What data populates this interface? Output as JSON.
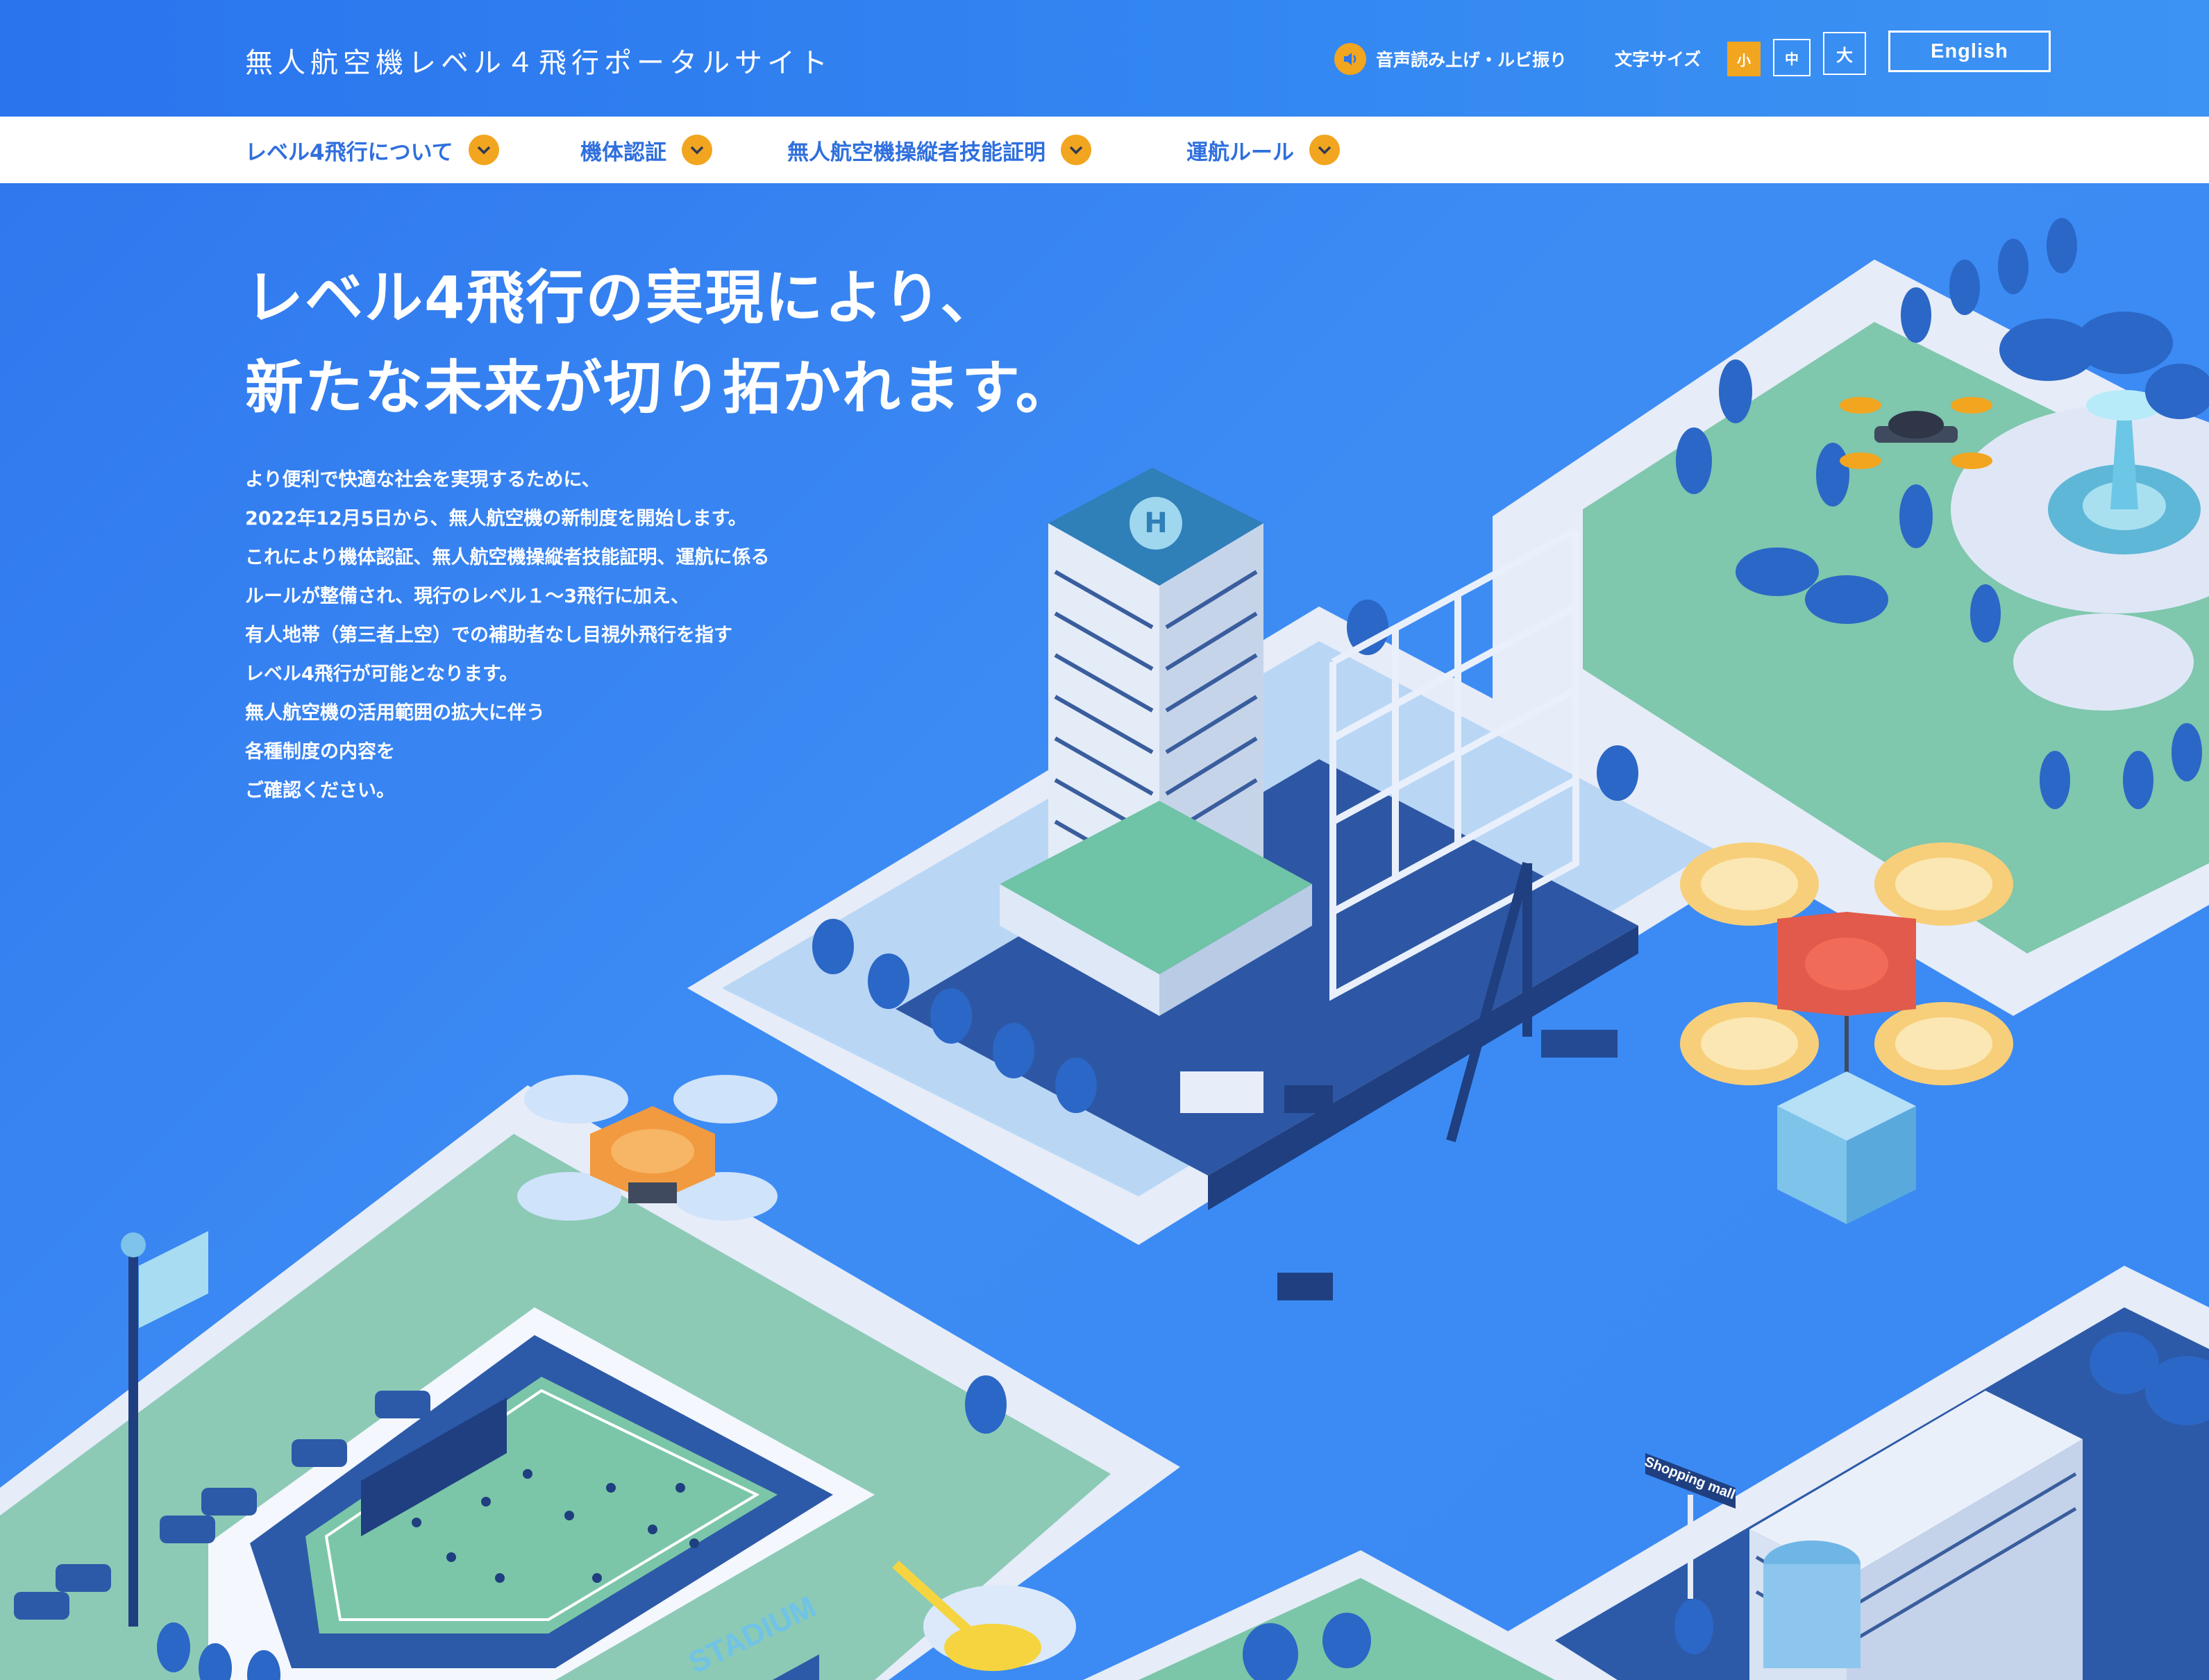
{
  "header": {
    "site_title": "無人航空機レベル４飛行ポータルサイト",
    "audio_label": "音声読み上げ・ルビ振り",
    "font_size_label": "文字サイズ",
    "font_sizes": [
      "小",
      "中",
      "大"
    ],
    "language_button": "English"
  },
  "nav": {
    "items": [
      {
        "label": "レベル4飛行について"
      },
      {
        "label": "機体認証"
      },
      {
        "label": "無人航空機操縦者技能証明"
      },
      {
        "label": "運航ルール"
      }
    ]
  },
  "hero": {
    "headline": [
      "レベル4飛行の実現により、",
      "新たな未来が切り拓かれます。"
    ],
    "lead": [
      "より便利で快適な社会を実現するために、",
      "2022年12月5日から、無人航空機の新制度を開始します。",
      "これにより機体認証、無人航空機操縦者技能証明、運航に係る",
      "ルールが整備され、現行のレベル１～3飛行に加え、",
      "有人地帯（第三者上空）での補助者なし目視外飛行を指す",
      "レベル4飛行が可能となります。",
      "無人航空機の活用範囲の拡大に伴う",
      "各種制度の内容を",
      "ご確認ください。"
    ],
    "illustration": {
      "helipad_mark": "H",
      "stadium_sign": "STADIUM",
      "mall_sign": "Shopping mall"
    }
  },
  "colors": {
    "header_blue": "#2a74ee",
    "accent_orange": "#f2a51f",
    "nav_text": "#2f6fde"
  }
}
